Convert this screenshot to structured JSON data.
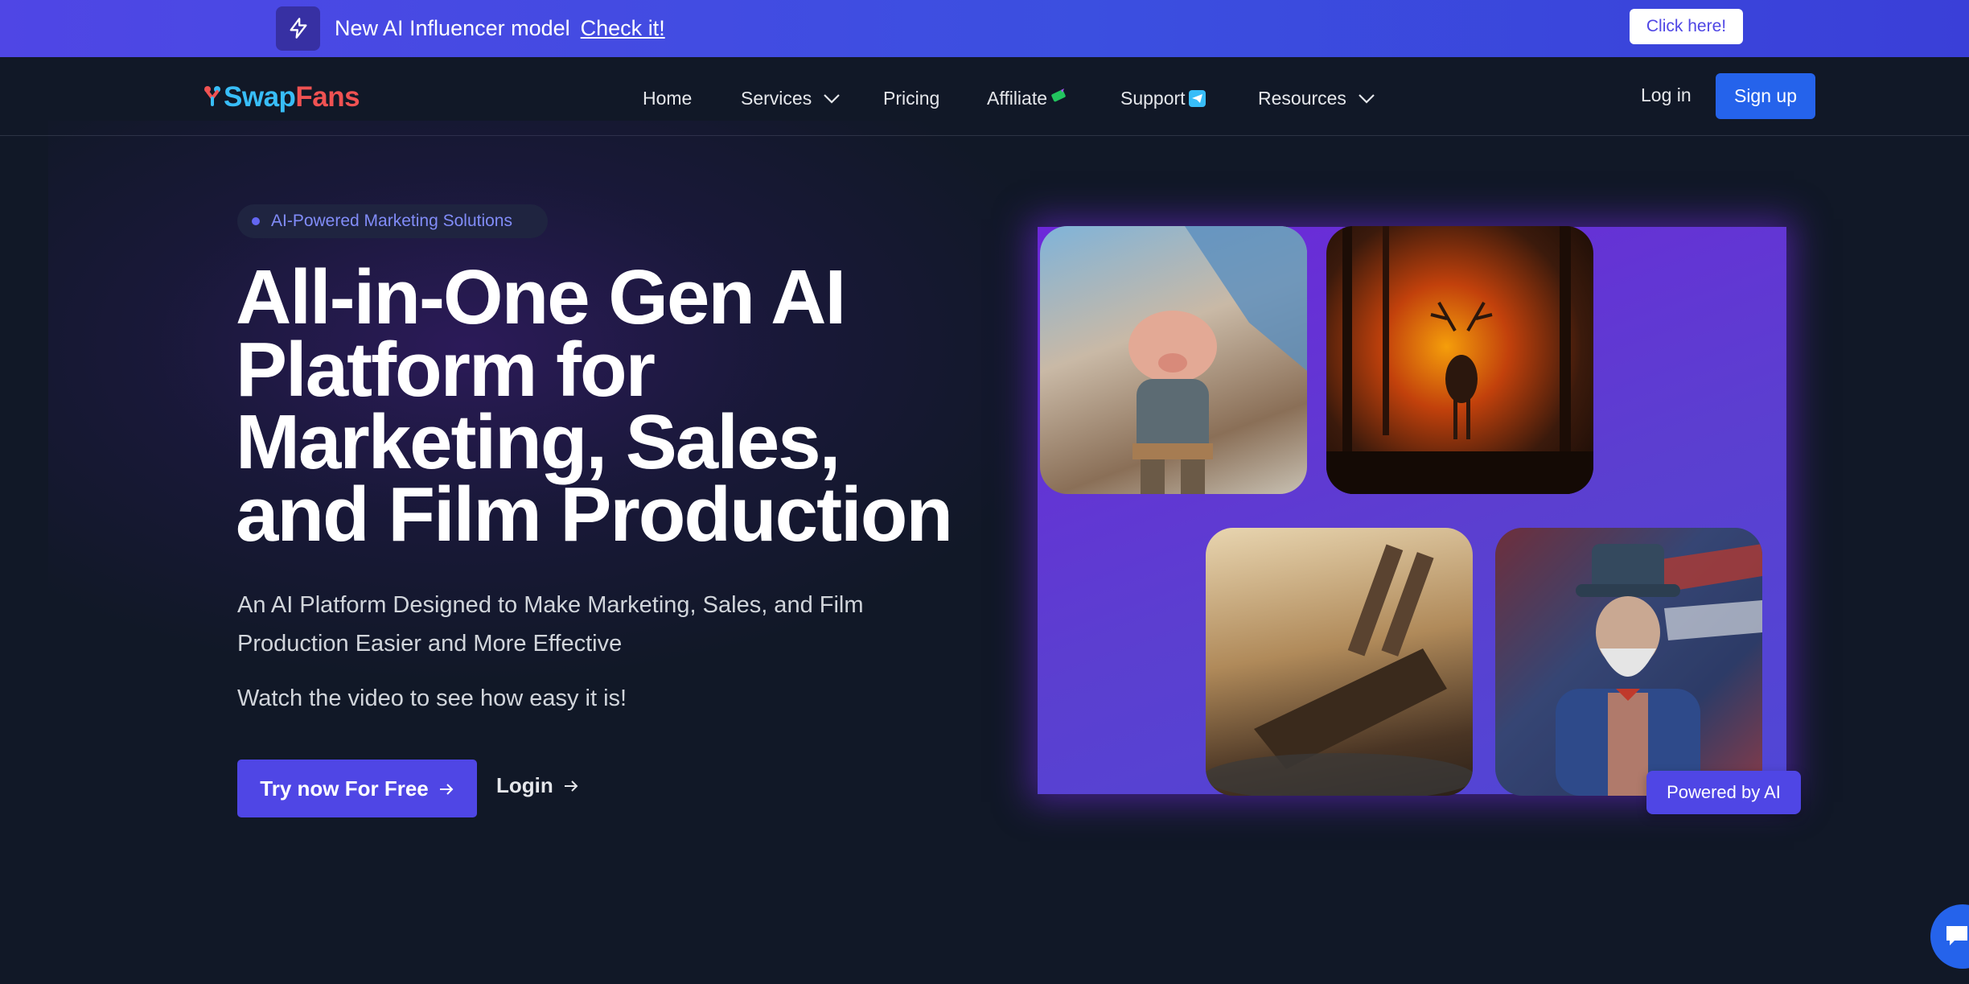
{
  "promo": {
    "text": "New AI Influencer model",
    "link": "Check it!",
    "cta": "Click here!"
  },
  "nav": {
    "logo_swap": "Swap",
    "logo_fans": "Fans",
    "items": [
      {
        "label": "Home"
      },
      {
        "label": "Services"
      },
      {
        "label": "Pricing"
      },
      {
        "label": "Affiliate"
      },
      {
        "label": "Support"
      },
      {
        "label": "Resources"
      }
    ],
    "login": "Log in",
    "signup": "Sign up"
  },
  "hero": {
    "pill": "AI-Powered Marketing Solutions",
    "title_lines": [
      "All-in-One Gen AI",
      "Platform for",
      "Marketing, Sales,",
      "and Film Production"
    ],
    "subtitle": "An AI Platform Designed to Make Marketing, Sales, and Film Production Easier and More Effective",
    "watch": "Watch the video to see how easy it is!",
    "try_button": "Try now For Free",
    "login_link": "Login"
  },
  "gallery": {
    "badge": "Powered by AI"
  },
  "colors": {
    "accent": "#4f46e5",
    "primary_button": "#2563eb",
    "background": "#111827",
    "logo_swap": "#38bdf8",
    "logo_fans": "#f05252"
  }
}
